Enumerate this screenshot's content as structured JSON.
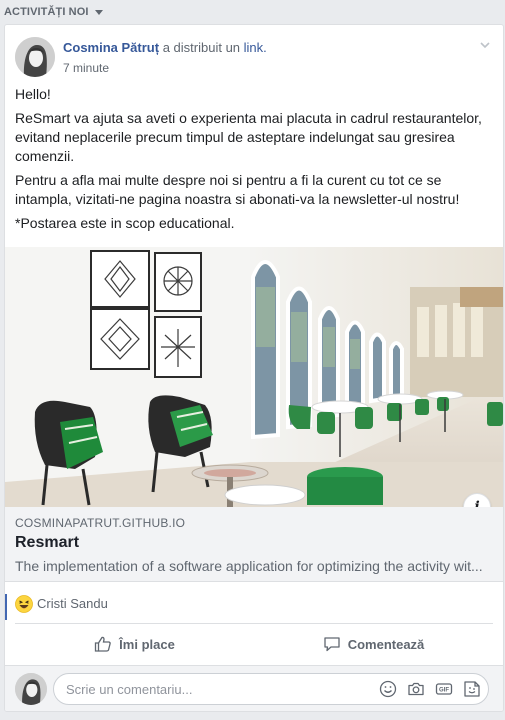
{
  "section": {
    "title": "ACTIVITĂȚI NOI"
  },
  "post": {
    "author": "Cosmina Pătruț",
    "action": "a distribuit un",
    "action_link": "link.",
    "timestamp": "7 minute",
    "paragraphs": [
      "Hello!",
      "ReSmart va ajuta sa aveti o experienta mai placuta in cadrul restaurantelor, evitand neplacerile precum timpul de asteptare indelungat sau gresirea comenzii.",
      "Pentru a afla mai multe despre noi si pentru a fi la curent cu tot ce se intampla, vizitati-ne pagina noastra si abonati-va la newsletter-ul nostru!",
      "*Postarea este in scop educational."
    ]
  },
  "link_preview": {
    "image_icon": "restaurant-interior-photo",
    "info_button": "i",
    "domain": "COSMINAPATRUT.GITHUB.IO",
    "title": "Resmart",
    "description": "The implementation of a software application for optimizing the activity wit..."
  },
  "reactions": {
    "emoji_icon": "haha-reaction-icon",
    "names": "Cristi Sandu"
  },
  "actions": {
    "like_label": "Îmi place",
    "comment_label": "Comentează"
  },
  "comment_box": {
    "placeholder": "Scrie un comentariu..."
  },
  "colors": {
    "link_blue": "#365899",
    "accent_blue": "#4267b2",
    "muted_text": "#606770",
    "background": "#e9ebee"
  }
}
